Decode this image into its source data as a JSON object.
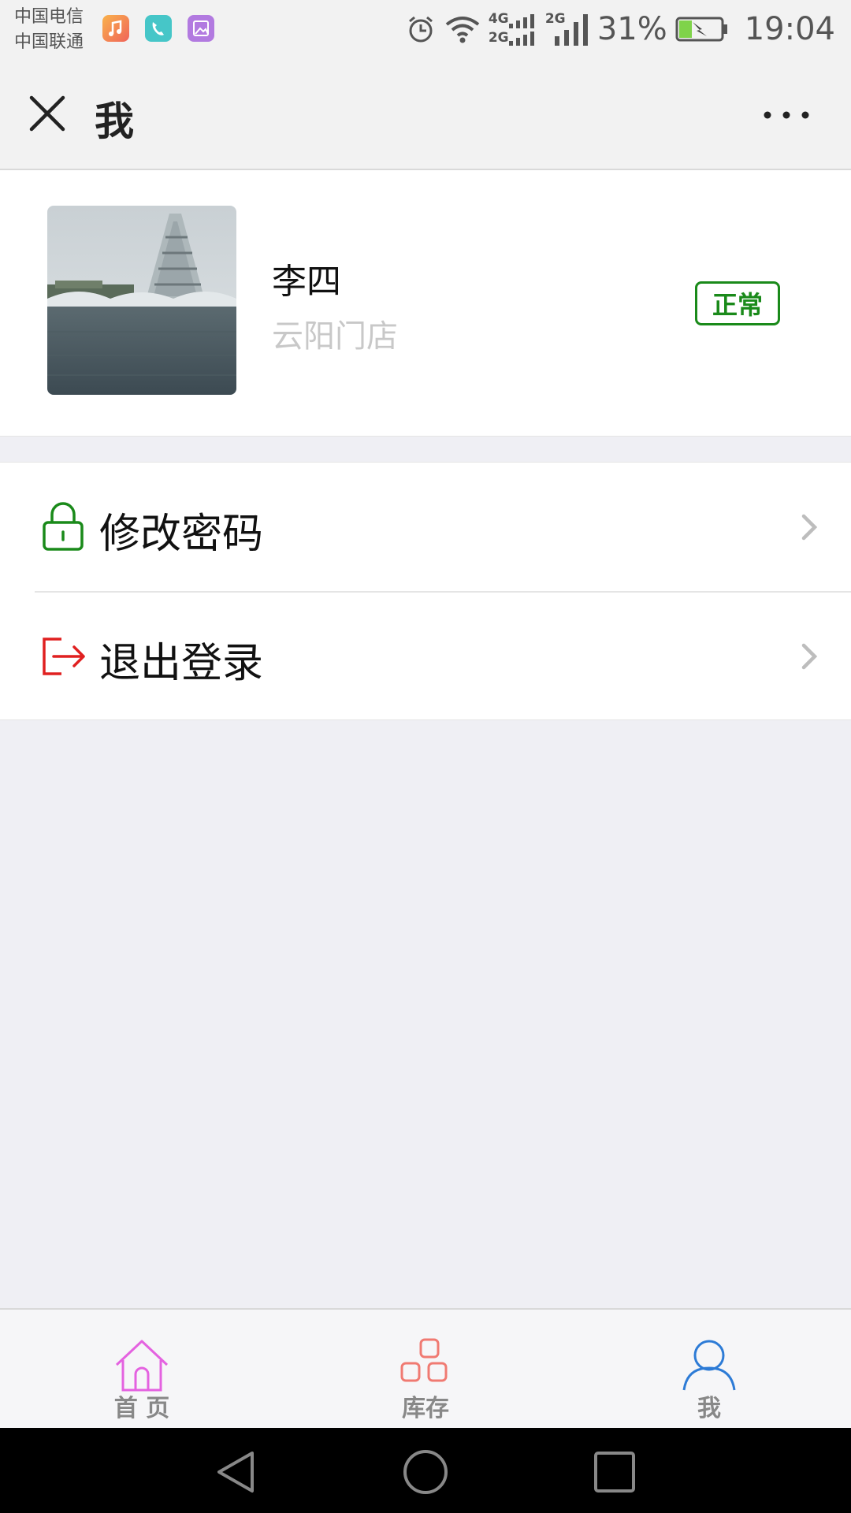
{
  "status_bar": {
    "carrier_1": "中国电信",
    "carrier_2": "中国联通",
    "network_1": "4G",
    "network_2": "2G",
    "network_3": "2G",
    "battery": "31%",
    "time": "19:04",
    "battery_level": 0.31
  },
  "nav": {
    "title": "我"
  },
  "profile": {
    "name": "李四",
    "store": "云阳门店",
    "status": "正常"
  },
  "menu": {
    "items": [
      {
        "label": "修改密码",
        "icon": "lock-icon"
      },
      {
        "label": "退出登录",
        "icon": "logout-icon"
      }
    ]
  },
  "tabbar": {
    "tabs": [
      {
        "label": "首 页",
        "icon": "home-icon",
        "color": "#e462e0"
      },
      {
        "label": "库存",
        "icon": "grid-icon",
        "color": "#f07a72"
      },
      {
        "label": "我",
        "icon": "user-icon",
        "color": "#2d7bd6"
      }
    ]
  },
  "colors": {
    "accent_green": "#1a8a1a",
    "logout_red": "#e02020"
  }
}
